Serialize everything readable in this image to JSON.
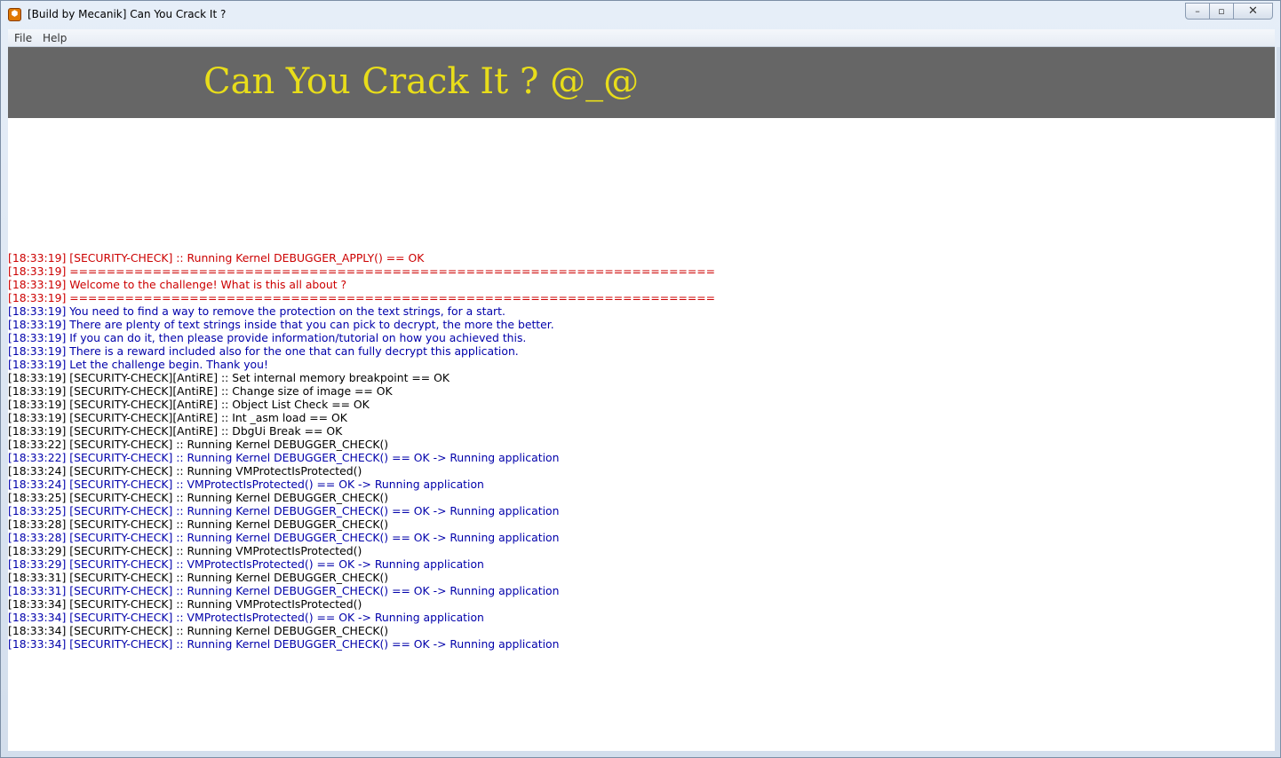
{
  "window": {
    "title": "[Build by Mecanik] Can You Crack It ?",
    "icon": "app-icon",
    "controls": {
      "minimize": "–",
      "maximize": "▫",
      "close": "✕"
    }
  },
  "menu": {
    "items": [
      {
        "label": "File"
      },
      {
        "label": "Help"
      }
    ]
  },
  "banner": {
    "title": "Can You Crack It ? @_@",
    "background": "#666666",
    "text_color": "#e8dd1a"
  },
  "colors": {
    "red": "#cc0000",
    "blue": "#0000aa",
    "black": "#000000"
  },
  "log": [
    {
      "color": "red",
      "text": "[18:33:19] [SECURITY-CHECK] :: Running Kernel DEBUGGER_APPLY() == OK"
    },
    {
      "color": "red",
      "text": "[18:33:19] ======================================================================"
    },
    {
      "color": "red",
      "text": "[18:33:19] Welcome to the challenge! What is this all about ?"
    },
    {
      "color": "red",
      "text": "[18:33:19] ======================================================================"
    },
    {
      "color": "blue",
      "text": "[18:33:19] You need to find a way to remove the protection on the text strings, for a start."
    },
    {
      "color": "blue",
      "text": "[18:33:19] There are plenty of text strings inside that you can pick to decrypt, the more the better."
    },
    {
      "color": "blue",
      "text": "[18:33:19] If you can do it, then please provide information/tutorial on how you achieved this."
    },
    {
      "color": "blue",
      "text": "[18:33:19] There is a reward included also for the one that can fully decrypt this application."
    },
    {
      "color": "blue",
      "text": "[18:33:19] Let the challenge begin. Thank you!"
    },
    {
      "color": "black",
      "text": "[18:33:19] [SECURITY-CHECK][AntiRE] :: Set internal memory breakpoint == OK"
    },
    {
      "color": "black",
      "text": "[18:33:19] [SECURITY-CHECK][AntiRE] :: Change size of image == OK"
    },
    {
      "color": "black",
      "text": "[18:33:19] [SECURITY-CHECK][AntiRE] :: Object List Check == OK"
    },
    {
      "color": "black",
      "text": "[18:33:19] [SECURITY-CHECK][AntiRE] :: Int _asm load == OK"
    },
    {
      "color": "black",
      "text": "[18:33:19] [SECURITY-CHECK][AntiRE] :: DbgUi Break == OK"
    },
    {
      "color": "black",
      "text": "[18:33:22] [SECURITY-CHECK] :: Running Kernel DEBUGGER_CHECK()"
    },
    {
      "color": "blue",
      "text": "[18:33:22] [SECURITY-CHECK] :: Running Kernel DEBUGGER_CHECK() == OK -> Running application"
    },
    {
      "color": "black",
      "text": "[18:33:24] [SECURITY-CHECK] :: Running VMProtectIsProtected()"
    },
    {
      "color": "blue",
      "text": "[18:33:24] [SECURITY-CHECK] :: VMProtectIsProtected() == OK -> Running application"
    },
    {
      "color": "black",
      "text": "[18:33:25] [SECURITY-CHECK] :: Running Kernel DEBUGGER_CHECK()"
    },
    {
      "color": "blue",
      "text": "[18:33:25] [SECURITY-CHECK] :: Running Kernel DEBUGGER_CHECK() == OK -> Running application"
    },
    {
      "color": "black",
      "text": "[18:33:28] [SECURITY-CHECK] :: Running Kernel DEBUGGER_CHECK()"
    },
    {
      "color": "blue",
      "text": "[18:33:28] [SECURITY-CHECK] :: Running Kernel DEBUGGER_CHECK() == OK -> Running application"
    },
    {
      "color": "black",
      "text": "[18:33:29] [SECURITY-CHECK] :: Running VMProtectIsProtected()"
    },
    {
      "color": "blue",
      "text": "[18:33:29] [SECURITY-CHECK] :: VMProtectIsProtected() == OK -> Running application"
    },
    {
      "color": "black",
      "text": "[18:33:31] [SECURITY-CHECK] :: Running Kernel DEBUGGER_CHECK()"
    },
    {
      "color": "blue",
      "text": "[18:33:31] [SECURITY-CHECK] :: Running Kernel DEBUGGER_CHECK() == OK -> Running application"
    },
    {
      "color": "black",
      "text": "[18:33:34] [SECURITY-CHECK] :: Running VMProtectIsProtected()"
    },
    {
      "color": "blue",
      "text": "[18:33:34] [SECURITY-CHECK] :: VMProtectIsProtected() == OK -> Running application"
    },
    {
      "color": "black",
      "text": "[18:33:34] [SECURITY-CHECK] :: Running Kernel DEBUGGER_CHECK()"
    },
    {
      "color": "blue",
      "text": "[18:33:34] [SECURITY-CHECK] :: Running Kernel DEBUGGER_CHECK() == OK -> Running application"
    }
  ]
}
